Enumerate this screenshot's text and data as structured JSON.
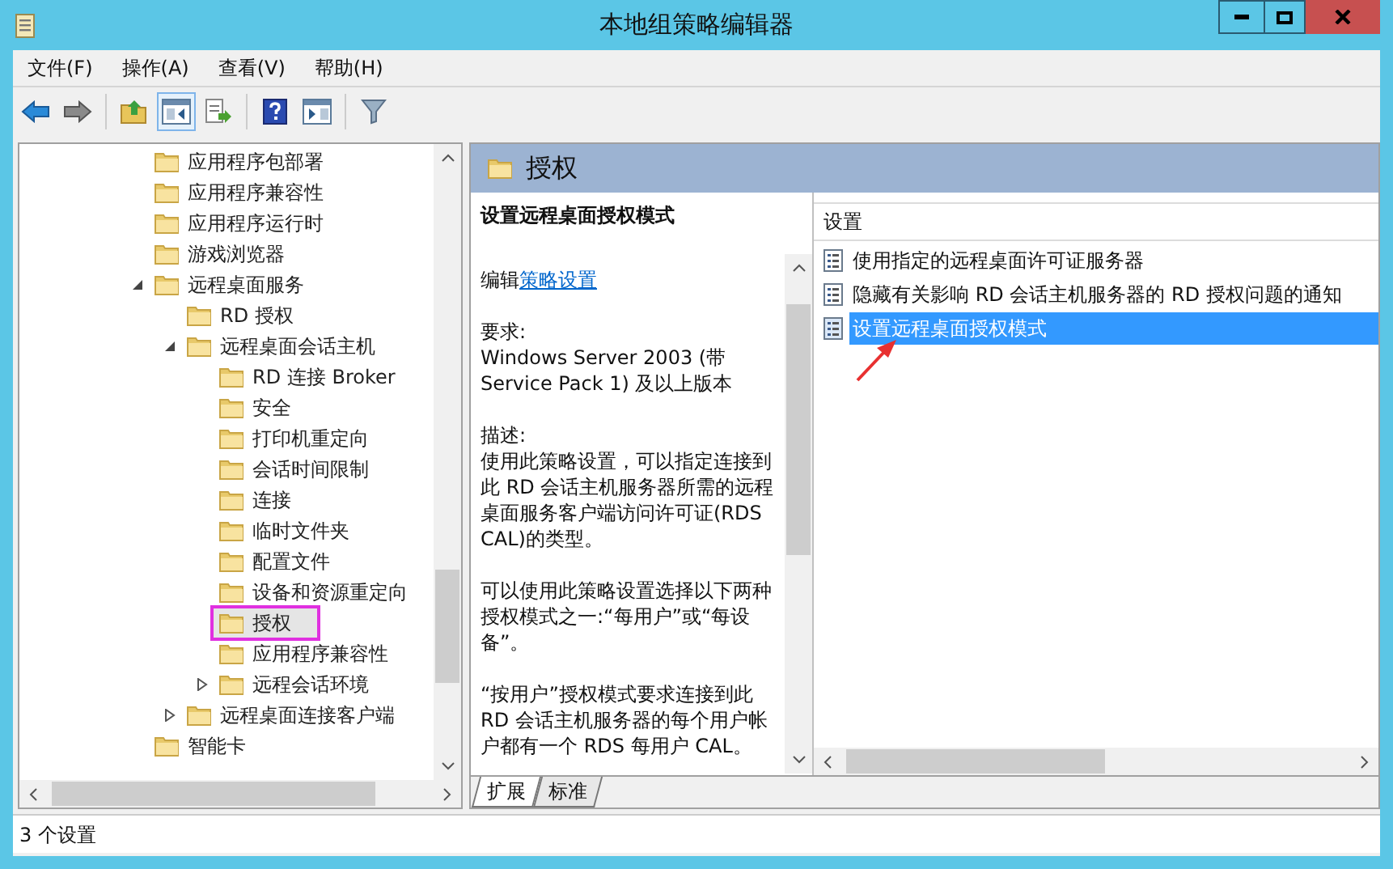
{
  "window": {
    "title": "本地组策略编辑器"
  },
  "menu": [
    {
      "label": "文件(F)"
    },
    {
      "label": "操作(A)"
    },
    {
      "label": "查看(V)"
    },
    {
      "label": "帮助(H)"
    }
  ],
  "tree": [
    {
      "label": "应用程序包部署",
      "selected": false
    },
    {
      "label": "应用程序兼容性",
      "selected": false
    },
    {
      "label": "应用程序运行时",
      "selected": false
    },
    {
      "label": "游戏浏览器",
      "selected": false
    },
    {
      "label": "远程桌面服务",
      "selected": false,
      "expanded": true,
      "children": [
        {
          "label": "RD 授权",
          "selected": false
        },
        {
          "label": "远程桌面会话主机",
          "selected": false,
          "expanded": true,
          "children": [
            {
              "label": "RD 连接 Broker",
              "selected": false
            },
            {
              "label": "安全",
              "selected": false
            },
            {
              "label": "打印机重定向",
              "selected": false
            },
            {
              "label": "会话时间限制",
              "selected": false
            },
            {
              "label": "连接",
              "selected": false
            },
            {
              "label": "临时文件夹",
              "selected": false
            },
            {
              "label": "配置文件",
              "selected": false
            },
            {
              "label": "设备和资源重定向",
              "selected": false
            },
            {
              "label": "授权",
              "selected": true
            },
            {
              "label": "应用程序兼容性",
              "selected": false
            },
            {
              "label": "远程会话环境",
              "selected": false,
              "expanded": false
            }
          ]
        },
        {
          "label": "远程桌面连接客户端",
          "selected": false,
          "expanded": false
        }
      ]
    },
    {
      "label": "智能卡",
      "selected": false
    }
  ],
  "detail": {
    "header": "授权",
    "description": {
      "title": "设置远程桌面授权模式",
      "edit_prefix": "编辑",
      "edit_link": "策略设置",
      "requirements_label": "要求:",
      "requirements": "Windows Server 2003 (带 Service Pack 1) 及以上版本",
      "description_label": "描述:",
      "paragraphs": [
        "使用此策略设置，可以指定连接到此 RD 会话主机服务器所需的远程桌面服务客户端访问许可证(RDS CAL)的类型。",
        "可以使用此策略设置选择以下两种授权模式之一:“每用户”或“每设备”。",
        "“按用户”授权模式要求连接到此 RD 会话主机服务器的每个用户帐户都有一个 RDS 每用户 CAL。"
      ]
    }
  },
  "list": {
    "column": "设置",
    "rows": [
      {
        "label": "使用指定的远程桌面许可证服务器",
        "selected": false
      },
      {
        "label": "隐藏有关影响 RD 会话主机服务器的 RD 授权问题的通知",
        "selected": false
      },
      {
        "label": "设置远程桌面授权模式",
        "selected": true
      }
    ]
  },
  "tabs": [
    {
      "label": "扩展",
      "selected": true
    },
    {
      "label": "标准",
      "selected": false
    }
  ],
  "status_bar": "3 个设置"
}
